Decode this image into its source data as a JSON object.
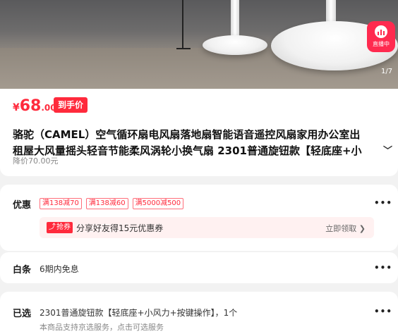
{
  "gallery": {
    "page_indicator": "1/7",
    "live_label": "直播中"
  },
  "price": {
    "currency": "¥",
    "integer": "68",
    "decimal": ".00",
    "badge": "到手价",
    "original": "降价70.00元"
  },
  "product": {
    "title_line1": "骆驼（CAMEL）空气循环扇电风扇落地扇智能语音遥控风扇家用办公室出",
    "title_line2": "租屋大风量摇头轻音节能柔风涡轮小换气扇 2301普通旋钮款【轻底座+小"
  },
  "promo": {
    "label": "优惠",
    "coupons": [
      "满138减70",
      "满138减60",
      "满5000减500"
    ],
    "share_badge": "抢券",
    "share_text": "分享好友得15元优惠券",
    "share_action": "立即领取 ❯"
  },
  "baitiao": {
    "label": "白条",
    "value": "6期内免息"
  },
  "selected": {
    "label": "已选",
    "value": "2301普通旋钮款【轻底座+小风力+按键操作】，1个",
    "sub": "本商品支持京选服务，点击可选服务"
  },
  "colors": {
    "accent": "#ff2a3c",
    "live": "#ff2a4f"
  }
}
